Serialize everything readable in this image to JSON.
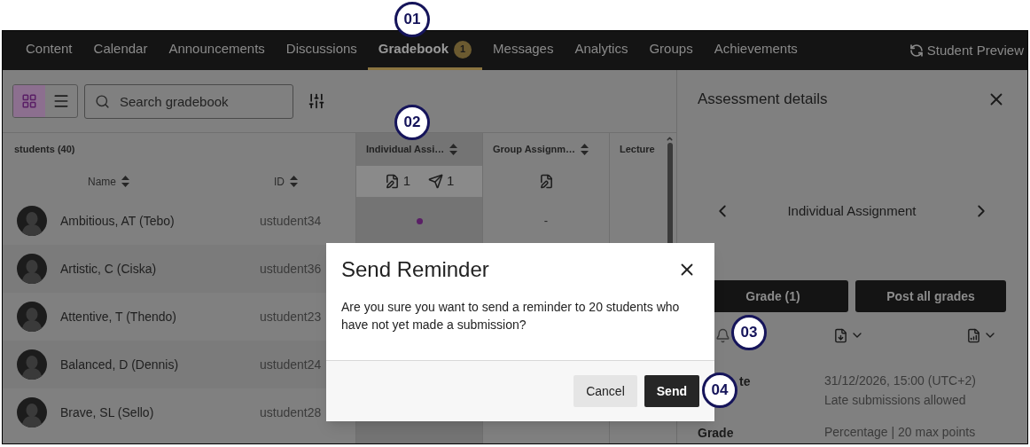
{
  "callouts": [
    "01",
    "02",
    "03",
    "04"
  ],
  "nav": {
    "tabs": [
      {
        "label": "Content",
        "selected": false
      },
      {
        "label": "Calendar",
        "selected": false
      },
      {
        "label": "Announcements",
        "selected": false
      },
      {
        "label": "Discussions",
        "selected": false
      },
      {
        "label": "Gradebook",
        "selected": true,
        "badge": "1"
      },
      {
        "label": "Messages",
        "selected": false
      },
      {
        "label": "Analytics",
        "selected": false
      },
      {
        "label": "Groups",
        "selected": false
      },
      {
        "label": "Achievements",
        "selected": false
      }
    ],
    "student_preview": "Student Preview"
  },
  "toolbar": {
    "view_modes": [
      {
        "kind": "grid",
        "selected": true
      },
      {
        "kind": "list",
        "selected": false
      }
    ],
    "search": {
      "placeholder": "Search gradebook"
    }
  },
  "grid": {
    "students_header": "students (40)",
    "name_header": "Name",
    "id_header": "ID",
    "columns": [
      {
        "title": "Individual Assi…",
        "selected": true,
        "counts": [
          {
            "kind": "submissions",
            "text": "1"
          },
          {
            "kind": "sent",
            "text": "1"
          }
        ]
      },
      {
        "title": "Group Assignm…",
        "selected": false,
        "counts": [
          {
            "kind": "submissions"
          }
        ]
      },
      {
        "title": "Lecture",
        "selected": false
      }
    ],
    "rows": [
      {
        "name": "Ambitious, AT (Tebo)",
        "id": "ustudent34",
        "cells": [
          {
            "kind": "dot"
          },
          {
            "kind": "text",
            "text": "-"
          }
        ]
      },
      {
        "name": "Artistic, C (Ciska)",
        "id": "ustudent36",
        "cells": []
      },
      {
        "name": "Attentive, T (Thendo)",
        "id": "ustudent23",
        "cells": []
      },
      {
        "name": "Balanced, D (Dennis)",
        "id": "ustudent24",
        "cells": []
      },
      {
        "name": "Brave, SL (Sello)",
        "id": "ustudent28",
        "cells": []
      }
    ]
  },
  "panel": {
    "title": "Assessment details",
    "item": "Individual Assignment",
    "buttons": [
      "Grade (1)",
      "Post all grades"
    ],
    "details": [
      {
        "label": "te",
        "values": [
          "31/12/2026, 15:00 (UTC+2)",
          "Late submissions allowed"
        ]
      },
      {
        "label": "Grade",
        "values": [
          "Percentage | 20 max points"
        ]
      }
    ]
  },
  "dialog": {
    "title": "Send Reminder",
    "message": "Are you sure you want to send a reminder to 20 students who have not yet made a submission?",
    "buttons": [
      {
        "label": "Cancel",
        "kind": "secondary"
      },
      {
        "label": "Send",
        "kind": "primary"
      }
    ]
  }
}
